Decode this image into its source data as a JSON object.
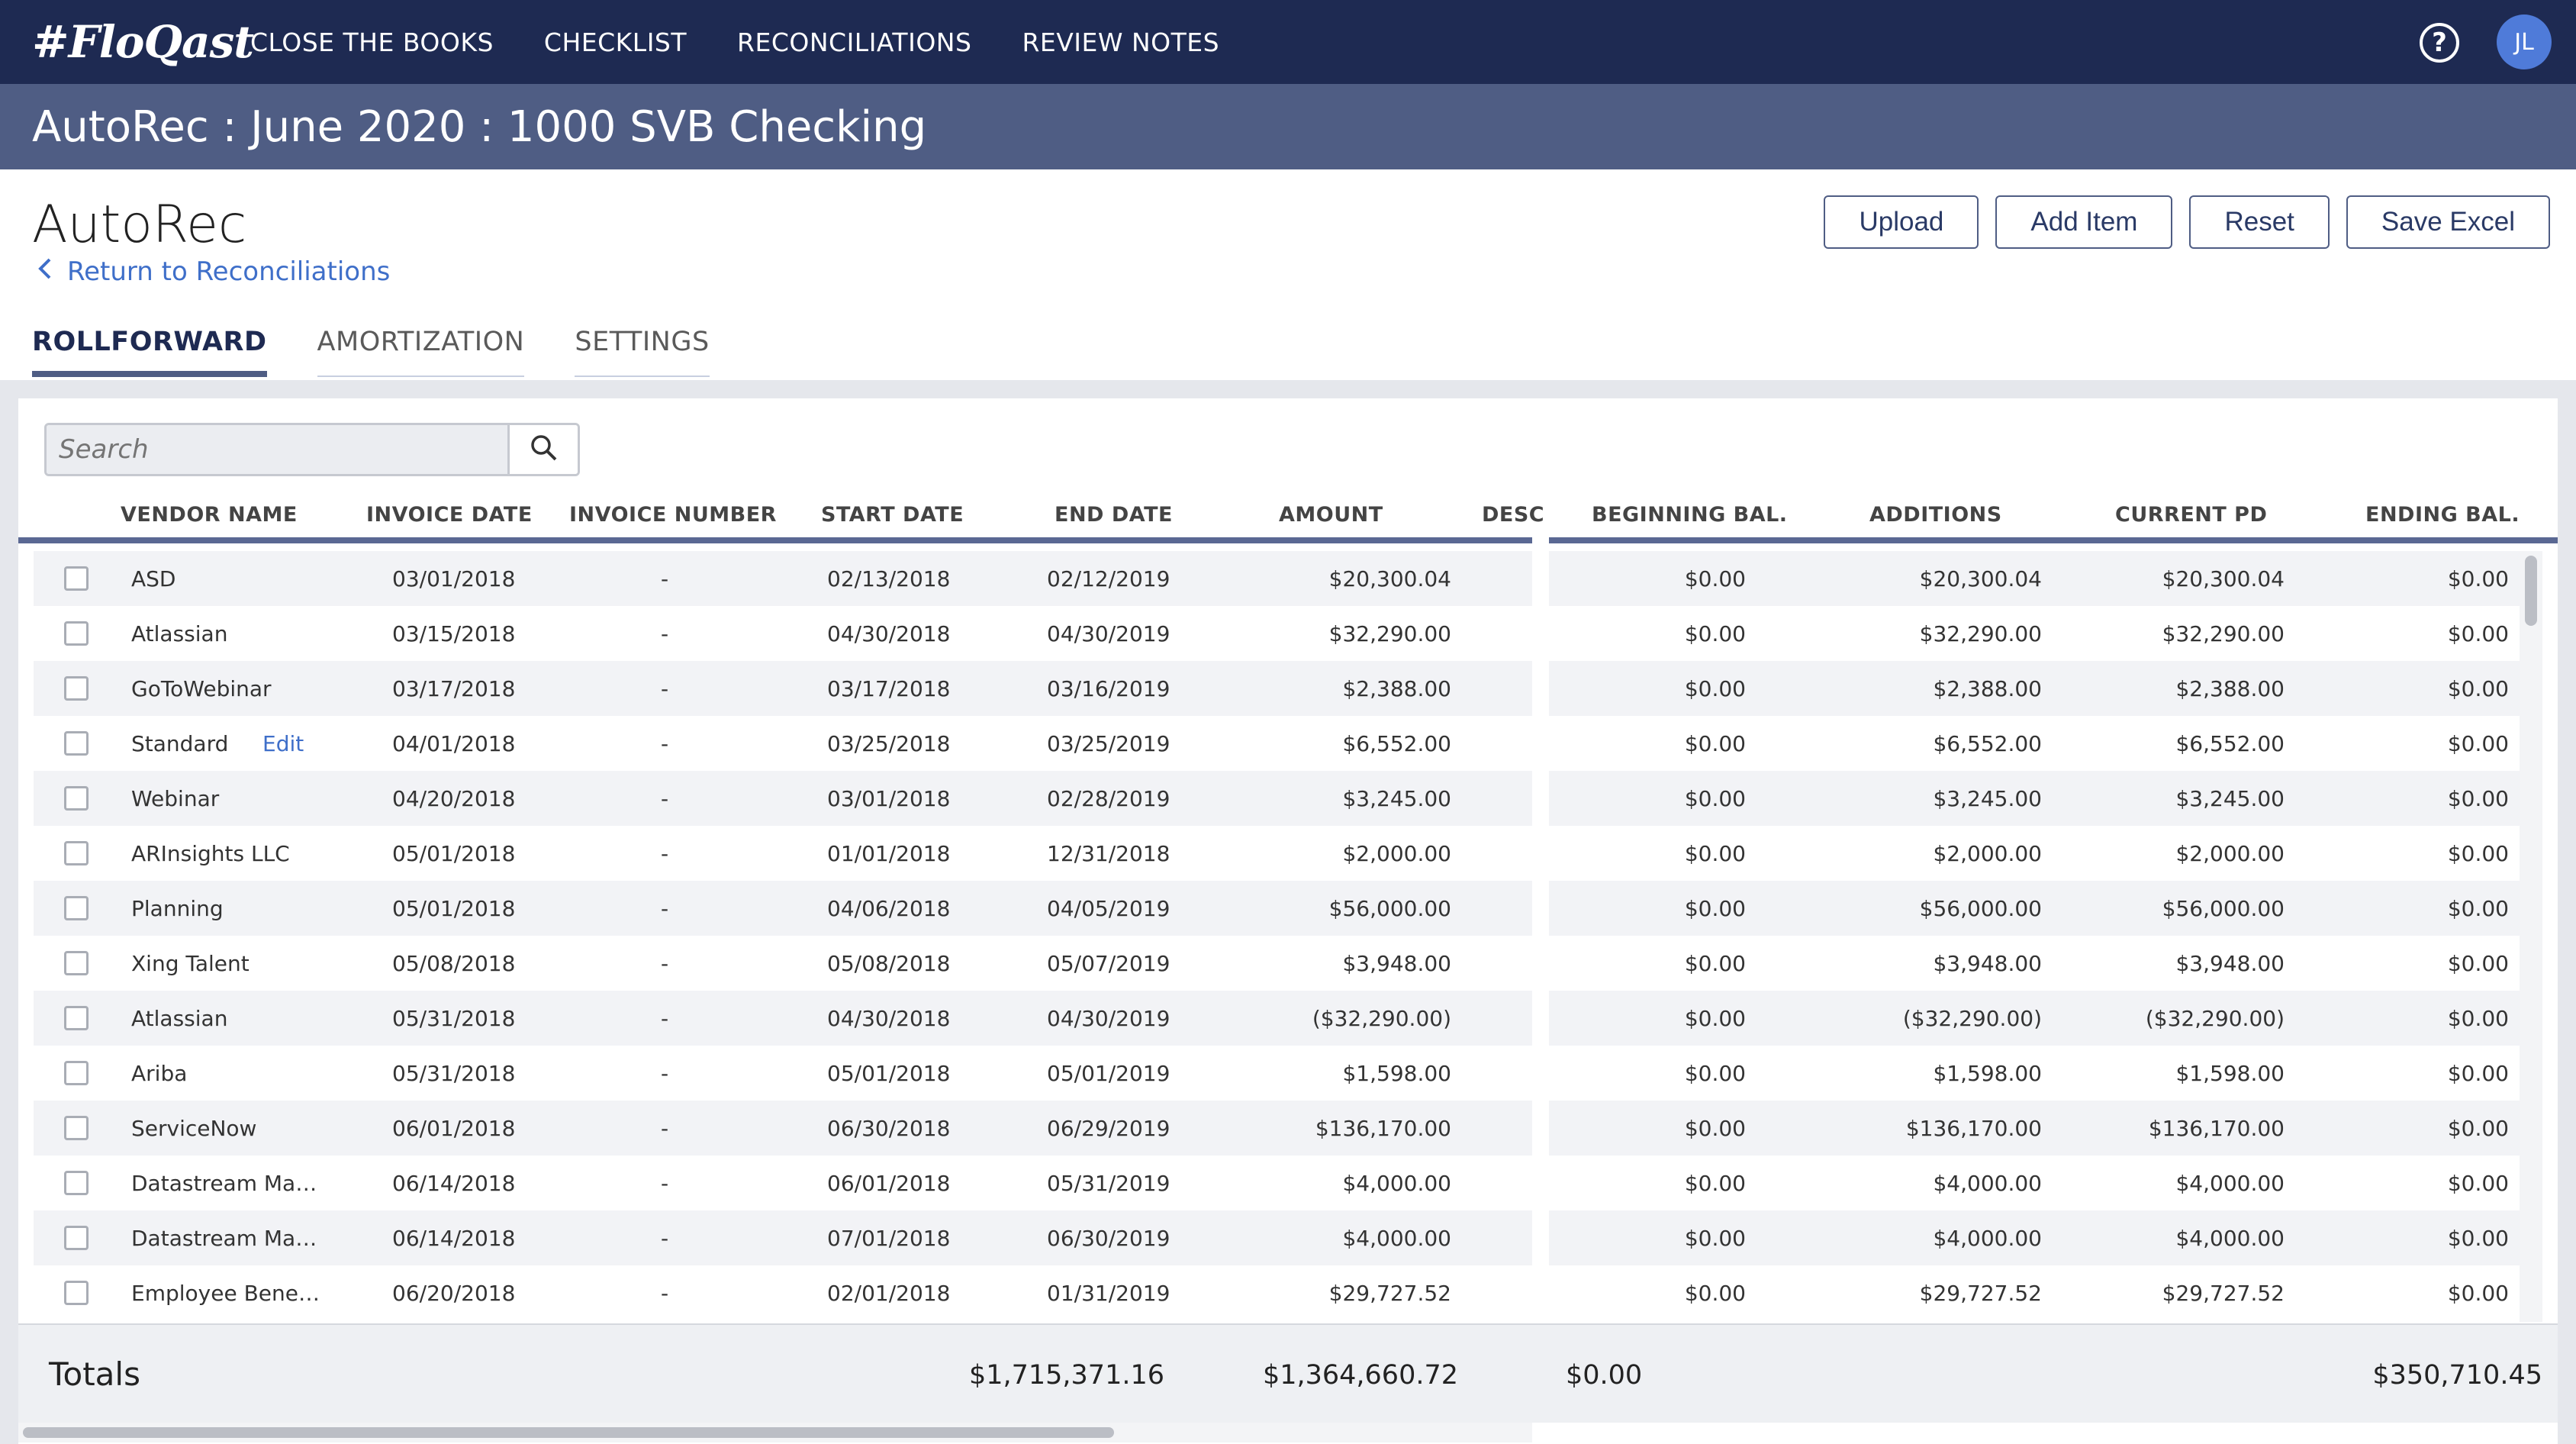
{
  "nav": {
    "logo": "#FloQast",
    "links": [
      "CLOSE THE BOOKS",
      "CHECKLIST",
      "RECONCILIATIONS",
      "REVIEW NOTES"
    ],
    "help_glyph": "?",
    "avatar_initials": "JL"
  },
  "subheader": {
    "title": "AutoRec : June 2020 : 1000 SVB Checking"
  },
  "page": {
    "title": "AutoRec",
    "back_link": "Return to Reconciliations"
  },
  "actions": {
    "upload": "Upload",
    "add_item": "Add Item",
    "reset": "Reset",
    "save_excel": "Save Excel"
  },
  "tabs": [
    {
      "label": "ROLLFORWARD",
      "active": true
    },
    {
      "label": "AMORTIZATION",
      "active": false
    },
    {
      "label": "SETTINGS",
      "active": false
    }
  ],
  "search": {
    "placeholder": "Search"
  },
  "columns_left": [
    "VENDOR NAME",
    "INVOICE DATE",
    "INVOICE NUMBER",
    "START DATE",
    "END DATE",
    "AMOUNT",
    "DESC"
  ],
  "columns_right": [
    "BEGINNING BAL.",
    "ADDITIONS",
    "CURRENT PD",
    "ENDING BAL."
  ],
  "rows": [
    {
      "vendor": "ASD",
      "edit": "",
      "invoice_date": "03/01/2018",
      "invoice_number": "-",
      "start": "02/13/2018",
      "end": "02/12/2019",
      "amount": "$20,300.04",
      "beg": "$0.00",
      "add": "$20,300.04",
      "cur": "$20,300.04",
      "endbal": "$0.00"
    },
    {
      "vendor": "Atlassian",
      "edit": "",
      "invoice_date": "03/15/2018",
      "invoice_number": "-",
      "start": "04/30/2018",
      "end": "04/30/2019",
      "amount": "$32,290.00",
      "beg": "$0.00",
      "add": "$32,290.00",
      "cur": "$32,290.00",
      "endbal": "$0.00"
    },
    {
      "vendor": "GoToWebinar",
      "edit": "",
      "invoice_date": "03/17/2018",
      "invoice_number": "-",
      "start": "03/17/2018",
      "end": "03/16/2019",
      "amount": "$2,388.00",
      "beg": "$0.00",
      "add": "$2,388.00",
      "cur": "$2,388.00",
      "endbal": "$0.00"
    },
    {
      "vendor": "Standard",
      "edit": "Edit",
      "invoice_date": "04/01/2018",
      "invoice_number": "-",
      "start": "03/25/2018",
      "end": "03/25/2019",
      "amount": "$6,552.00",
      "beg": "$0.00",
      "add": "$6,552.00",
      "cur": "$6,552.00",
      "endbal": "$0.00"
    },
    {
      "vendor": "Webinar",
      "edit": "",
      "invoice_date": "04/20/2018",
      "invoice_number": "-",
      "start": "03/01/2018",
      "end": "02/28/2019",
      "amount": "$3,245.00",
      "beg": "$0.00",
      "add": "$3,245.00",
      "cur": "$3,245.00",
      "endbal": "$0.00"
    },
    {
      "vendor": "ARInsights LLC",
      "edit": "",
      "invoice_date": "05/01/2018",
      "invoice_number": "-",
      "start": "01/01/2018",
      "end": "12/31/2018",
      "amount": "$2,000.00",
      "beg": "$0.00",
      "add": "$2,000.00",
      "cur": "$2,000.00",
      "endbal": "$0.00"
    },
    {
      "vendor": "Planning",
      "edit": "",
      "invoice_date": "05/01/2018",
      "invoice_number": "-",
      "start": "04/06/2018",
      "end": "04/05/2019",
      "amount": "$56,000.00",
      "beg": "$0.00",
      "add": "$56,000.00",
      "cur": "$56,000.00",
      "endbal": "$0.00"
    },
    {
      "vendor": "Xing Talent",
      "edit": "",
      "invoice_date": "05/08/2018",
      "invoice_number": "-",
      "start": "05/08/2018",
      "end": "05/07/2019",
      "amount": "$3,948.00",
      "beg": "$0.00",
      "add": "$3,948.00",
      "cur": "$3,948.00",
      "endbal": "$0.00"
    },
    {
      "vendor": "Atlassian",
      "edit": "",
      "invoice_date": "05/31/2018",
      "invoice_number": "-",
      "start": "04/30/2018",
      "end": "04/30/2019",
      "amount": "($32,290.00)",
      "beg": "$0.00",
      "add": "($32,290.00)",
      "cur": "($32,290.00)",
      "endbal": "$0.00"
    },
    {
      "vendor": "Ariba",
      "edit": "",
      "invoice_date": "05/31/2018",
      "invoice_number": "-",
      "start": "05/01/2018",
      "end": "05/01/2019",
      "amount": "$1,598.00",
      "beg": "$0.00",
      "add": "$1,598.00",
      "cur": "$1,598.00",
      "endbal": "$0.00"
    },
    {
      "vendor": "ServiceNow",
      "edit": "",
      "invoice_date": "06/01/2018",
      "invoice_number": "-",
      "start": "06/30/2018",
      "end": "06/29/2019",
      "amount": "$136,170.00",
      "beg": "$0.00",
      "add": "$136,170.00",
      "cur": "$136,170.00",
      "endbal": "$0.00"
    },
    {
      "vendor": "Datastream Mana...",
      "edit": "",
      "invoice_date": "06/14/2018",
      "invoice_number": "-",
      "start": "06/01/2018",
      "end": "05/31/2019",
      "amount": "$4,000.00",
      "beg": "$0.00",
      "add": "$4,000.00",
      "cur": "$4,000.00",
      "endbal": "$0.00"
    },
    {
      "vendor": "Datastream Mana...",
      "edit": "",
      "invoice_date": "06/14/2018",
      "invoice_number": "-",
      "start": "07/01/2018",
      "end": "06/30/2019",
      "amount": "$4,000.00",
      "beg": "$0.00",
      "add": "$4,000.00",
      "cur": "$4,000.00",
      "endbal": "$0.00"
    },
    {
      "vendor": "Employee Benefit I...",
      "edit": "",
      "invoice_date": "06/20/2018",
      "invoice_number": "-",
      "start": "02/01/2018",
      "end": "01/31/2019",
      "amount": "$29,727.52",
      "beg": "$0.00",
      "add": "$29,727.52",
      "cur": "$29,727.52",
      "endbal": "$0.00"
    }
  ],
  "totals": {
    "label": "Totals",
    "beginning": "$0.00",
    "additions": "$1,715,371.16",
    "current": "$1,364,660.72",
    "ending": "$350,710.45"
  },
  "colors": {
    "nav_bg": "#1e2a52",
    "subheader_bg": "#4f5d84",
    "accent_link": "#3f6fc9",
    "avatar_bg": "#4f7bd9"
  }
}
